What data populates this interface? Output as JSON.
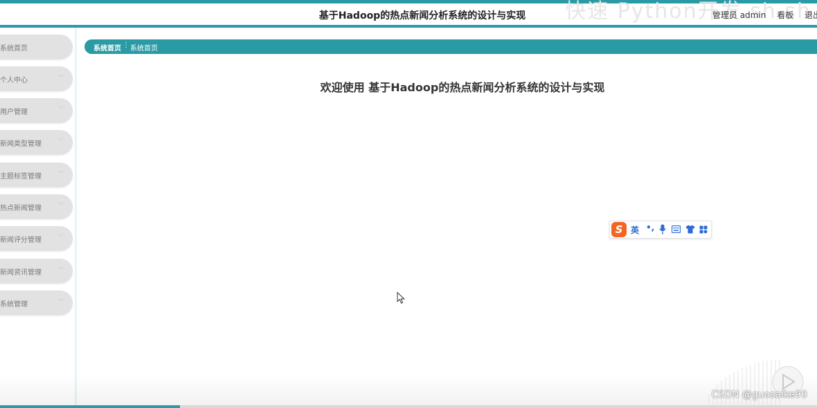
{
  "header": {
    "title": "基于Hadoop的热点新闻分析系统的设计与实现",
    "user_label": "管理员 admin",
    "dashboard_label": "看板",
    "logout_label": "退出",
    "watermark": "快速 Python开发 sh sh"
  },
  "sidebar": {
    "items": [
      {
        "label": "系统首页",
        "has_chevron": false
      },
      {
        "label": "个人中心",
        "has_chevron": true
      },
      {
        "label": "用户管理",
        "has_chevron": true
      },
      {
        "label": "新闻类型管理",
        "has_chevron": true
      },
      {
        "label": "主题标签管理",
        "has_chevron": true
      },
      {
        "label": "热点新闻管理",
        "has_chevron": true
      },
      {
        "label": "新闻评分管理",
        "has_chevron": true
      },
      {
        "label": "新闻资讯管理",
        "has_chevron": true
      },
      {
        "label": "系统管理",
        "has_chevron": true
      }
    ]
  },
  "breadcrumb": {
    "home": "系统首页",
    "separator": "⋮",
    "current": "系统首页"
  },
  "main": {
    "welcome": "欢迎使用 基于Hadoop的热点新闻分析系统的设计与实现"
  },
  "ime_toolbar": {
    "logo": "S",
    "language": "英",
    "punctuation": "•,",
    "icons": [
      "microphone-icon",
      "keyboard-icon",
      "shirt-icon",
      "grid-icon"
    ]
  },
  "video": {
    "progress": 0.22
  },
  "watermark": "CSDN @guosaike99",
  "colors": {
    "accent": "#2a9aa5",
    "menu_bg": "#e2e2e2",
    "ime_orange": "#f26522",
    "ime_blue": "#2b6bd6"
  }
}
